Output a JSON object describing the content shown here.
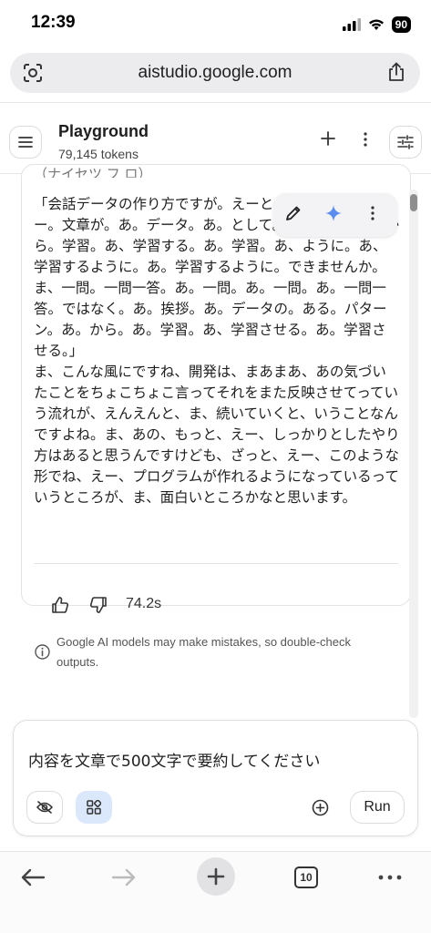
{
  "status": {
    "time": "12:39",
    "battery": "90"
  },
  "browser": {
    "url": "aistudio.google.com",
    "tab_count": "10"
  },
  "header": {
    "title": "Playground",
    "tokens": "79,145 tokens"
  },
  "chat": {
    "cut_top_line": "（ナイセツ フ ロ）",
    "response_text": "「会話データの作り方ですが。えーと。あ。ある。えー。文章が。あ。データ。あ。として。あ。あ。ある。から。学習。あ、学習する。あ。学習。あ、ように。あ、学習するように。あ。学習するように。できませんか。ま、一問。一問一答。あ。一問。あ。一問。あ。一問一答。ではなく。あ。挨拶。あ。データの。ある。パターン。あ。から。あ。学習。あ、学習させる。あ。学習させる。」\nま、こんな風にですね、開発は、まあまあ、あの気づいたことをちょこちょこ言ってそれをまた反映させてっていう流れが、えんえんと、ま、続いていくと、いうことなんですよね。ま、あの、もっと、えー、しっかりとしたやり方はあると思うんですけども、ざっと、えー、このような形でね、えー、プログラムが作れるようになっているっていうところが、ま、面白いところかなと思います。",
    "elapsed": "74.2s",
    "disclaimer": "Google AI models may make mistakes, so double-check outputs."
  },
  "input": {
    "text": "内容を文章で500文字で要約してください",
    "run_label": "Run"
  },
  "colors": {
    "accent_blue": "#1a73e8",
    "chip_bg": "#dbe7fb",
    "sparkle": "#4b7bec"
  }
}
